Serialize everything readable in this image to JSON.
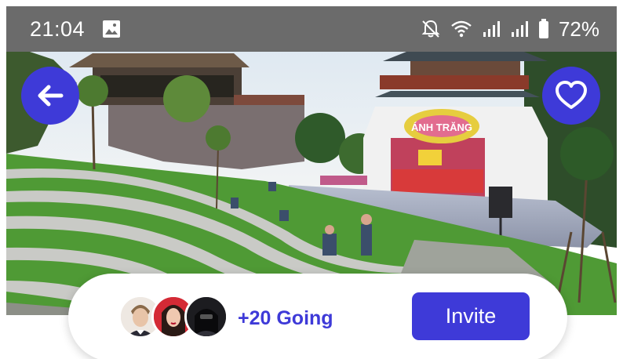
{
  "status_bar": {
    "time": "21:04",
    "battery": "72%",
    "icons": [
      "image-icon",
      "bell-off-icon",
      "wifi-icon",
      "signal-icon",
      "signal-icon",
      "battery-icon"
    ]
  },
  "hero": {
    "sign_text": "ÁNH TRĂNG",
    "back_icon": "arrow-left-icon",
    "favorite_icon": "heart-icon"
  },
  "going": {
    "label": "+20 Going",
    "invite_label": "Invite",
    "avatars": [
      "avatar-1",
      "avatar-2",
      "avatar-3"
    ]
  },
  "colors": {
    "accent": "#3e3ad8",
    "status_bar": "#6b6b6b"
  }
}
